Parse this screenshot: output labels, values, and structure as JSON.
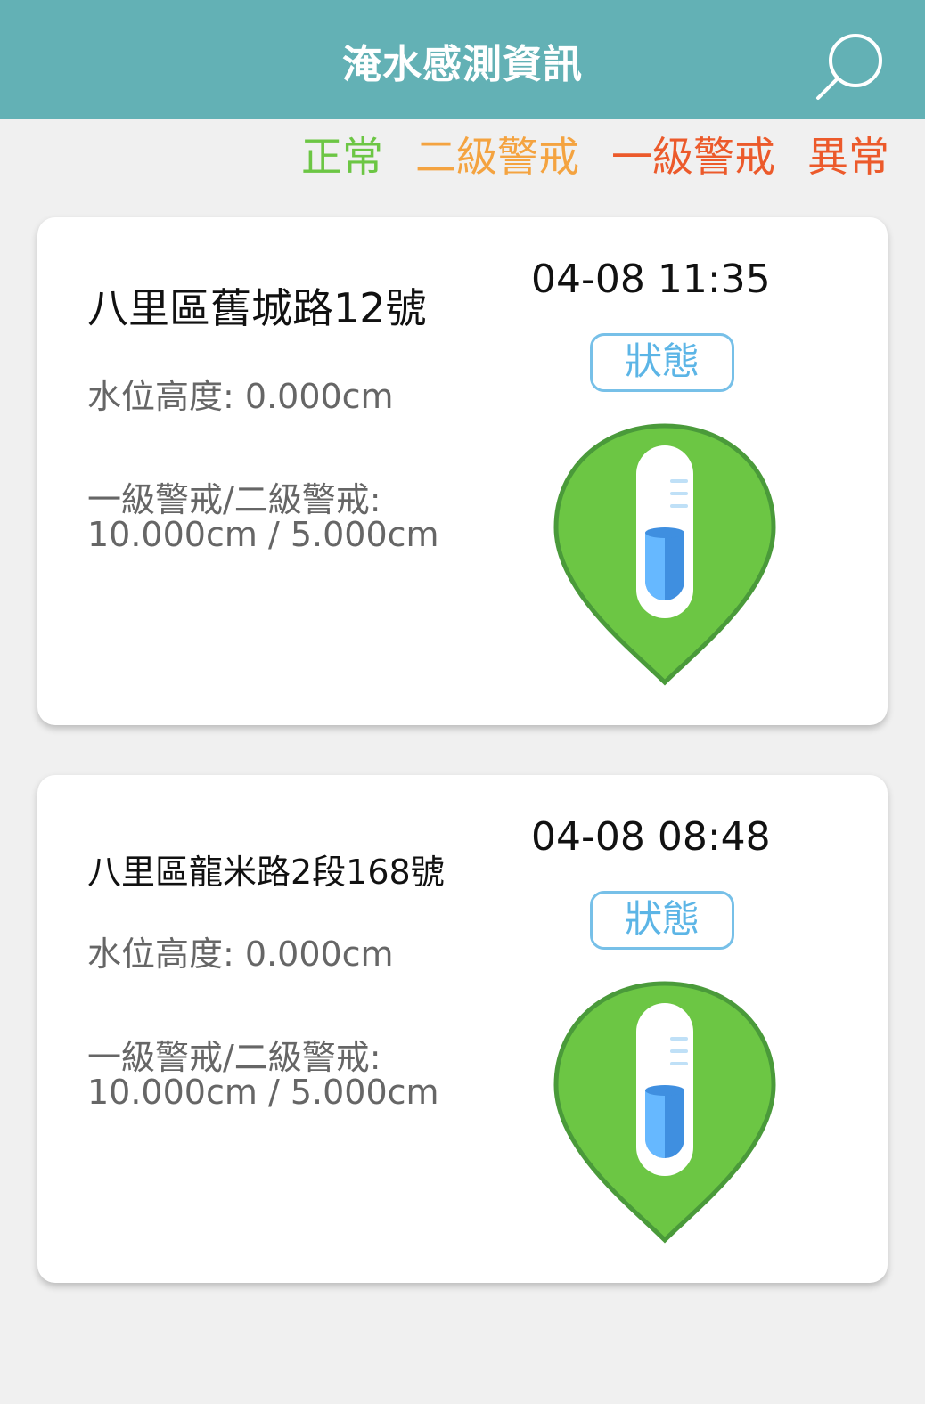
{
  "header": {
    "title": "淹水感測資訊"
  },
  "legend": {
    "items": [
      {
        "label": "正常",
        "color": "#6cc644"
      },
      {
        "label": "二級警戒",
        "color": "#f4a340"
      },
      {
        "label": "一級警戒",
        "color": "#ec5a2b"
      },
      {
        "label": "異常",
        "color": "#ec5a2b"
      }
    ]
  },
  "colors": {
    "header_bg": "#63b1b5",
    "pin_fill": "#6cc644",
    "pin_stroke": "#4a9a3a",
    "status_border": "#77c0e8"
  },
  "sensors": [
    {
      "address": "八里區舊城路12號",
      "time": "04-08 11:35",
      "status_label": "狀態",
      "water_level": "水位高度: 0.000cm",
      "warning_label": "一級警戒/二級警戒:",
      "warning_values": "10.000cm / 5.000cm",
      "icon": "green-thermometer-pin-icon"
    },
    {
      "address": "八里區龍米路2段168號",
      "time": "04-08 08:48",
      "status_label": "狀態",
      "water_level": "水位高度: 0.000cm",
      "warning_label": "一級警戒/二級警戒:",
      "warning_values": "10.000cm / 5.000cm",
      "icon": "green-thermometer-pin-icon"
    }
  ]
}
